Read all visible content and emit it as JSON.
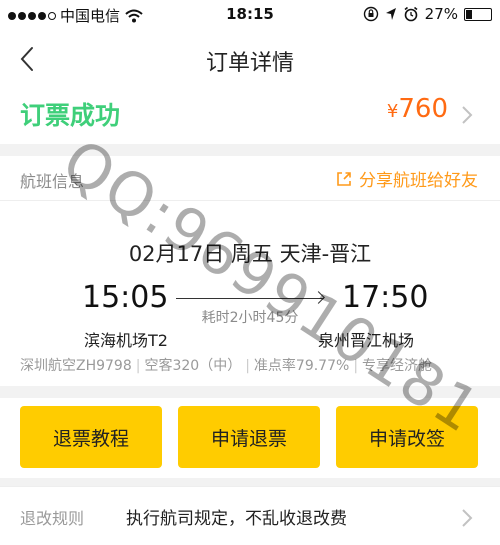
{
  "status_bar": {
    "carrier": "中国电信",
    "time": "18:15",
    "battery": "27%",
    "battery_level": 0.27
  },
  "nav": {
    "title": "订单详情"
  },
  "order": {
    "status": "订票成功",
    "currency": "¥",
    "price": "760"
  },
  "flight": {
    "section_label": "航班信息",
    "share_label": "分享航班给好友",
    "date_route": "02月17日 周五  天津-晋江",
    "dep_time": "15:05",
    "arr_time": "17:50",
    "duration": "耗时2小时45分",
    "dep_airport": "滨海机场T2",
    "arr_airport": "泉州晋江机场",
    "info": [
      "深圳航空ZH9798",
      "空客320（中）",
      "准点率79.77%",
      "专享经济舱"
    ]
  },
  "actions": [
    "退票教程",
    "申请退票",
    "申请改签"
  ],
  "rules": {
    "label": "退改规则",
    "text": "执行航司规定，不乱收退改费"
  },
  "watermark": "QQ:969910181",
  "colors": {
    "success": "#3fcf7a",
    "price": "#ff6a12",
    "button": "#ffcc00",
    "share": "#ff9a1a"
  }
}
